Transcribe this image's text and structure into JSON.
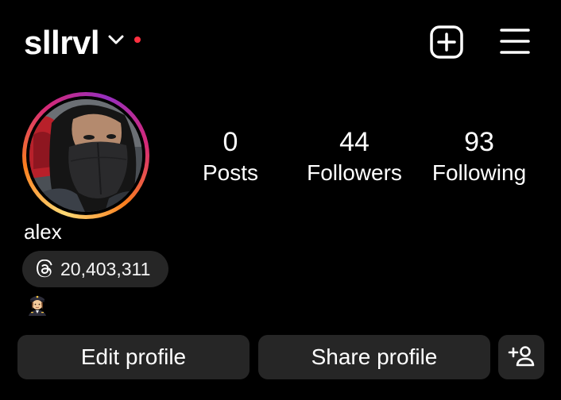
{
  "header": {
    "username": "sllrvl",
    "icons": {
      "switch": "chevron-down-icon",
      "notification": "notification-dot-icon",
      "create": "plus-square-icon",
      "menu": "hamburger-menu-icon"
    },
    "colors": {
      "notification_dot": "#ff3040"
    }
  },
  "profile": {
    "avatar": "profile-photo",
    "display_name": "alex",
    "bio_emoji": "👩‍✈️",
    "threads_badge": {
      "icon": "threads-icon",
      "count": "20,403,311"
    }
  },
  "stats": [
    {
      "value": "0",
      "label": "Posts"
    },
    {
      "value": "44",
      "label": "Followers"
    },
    {
      "value": "93",
      "label": "Following"
    }
  ],
  "actions": {
    "edit_label": "Edit profile",
    "share_label": "Share profile",
    "add_person_icon": "add-person-icon"
  },
  "colors": {
    "background": "#000000",
    "button_bg": "#262626",
    "story_ring": [
      "#feda75",
      "#fa7e1e",
      "#d62976",
      "#962fbf"
    ]
  }
}
